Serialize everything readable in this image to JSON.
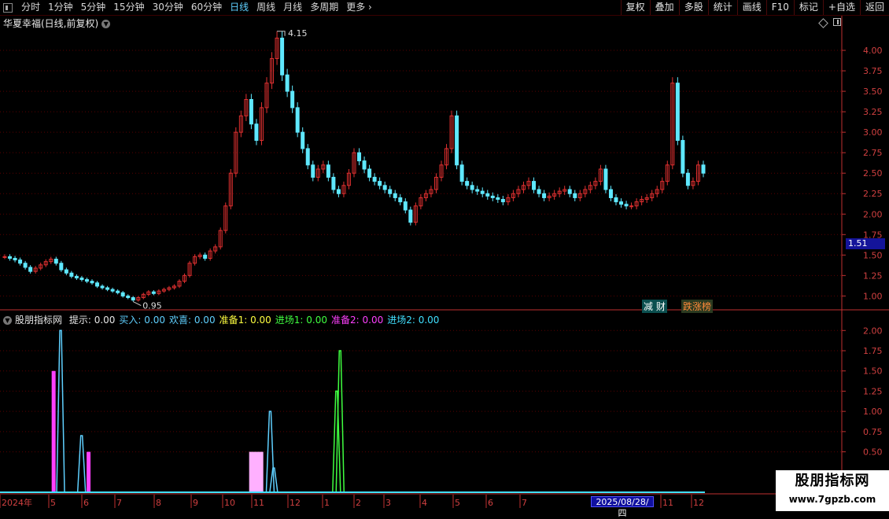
{
  "toolbar": {
    "periods": [
      "分时",
      "1分钟",
      "5分钟",
      "15分钟",
      "30分钟",
      "60分钟",
      "日线",
      "周线",
      "月线",
      "多周期",
      "更多 ›"
    ],
    "active_index": 6,
    "right_buttons": [
      "复权",
      "叠加",
      "多股",
      "统计",
      "画线",
      "F10",
      "标记",
      "+自选",
      "返回"
    ]
  },
  "stock": {
    "title": "华夏幸福(日线,前复权)"
  },
  "price_axis": {
    "ticks": [
      "4.00",
      "3.75",
      "3.50",
      "3.25",
      "3.00",
      "2.75",
      "2.50",
      "2.25",
      "2.00",
      "1.75",
      "1.50",
      "1.25",
      "1.00"
    ]
  },
  "current_price_badge": "1.51",
  "annotations": {
    "high_label": "4.15",
    "low_label": "0.95"
  },
  "tags": [
    {
      "text": "减 财",
      "color": "#ffffff",
      "bg": "#0b4f4f"
    },
    {
      "text": "跌涨榜",
      "color": "#ff8a3a",
      "bg": "#2b3a20"
    }
  ],
  "indicator": {
    "name": "股朋指标网",
    "fields": [
      {
        "label": "提示: 0.00",
        "color": "#e6e6e6"
      },
      {
        "label": "买入: 0.00",
        "color": "#5fd0ff"
      },
      {
        "label": "欢喜: 0.00",
        "color": "#5fd0ff"
      },
      {
        "label": "准备1: 0.00",
        "color": "#ffff40"
      },
      {
        "label": "进场1: 0.00",
        "color": "#40ff40"
      },
      {
        "label": "准备2: 0.00",
        "color": "#ff40ff"
      },
      {
        "label": "进场2: 0.00",
        "color": "#40e0ff"
      }
    ],
    "axis_ticks": [
      "2.00",
      "1.75",
      "1.50",
      "1.25",
      "1.00",
      "0.75",
      "0.50"
    ]
  },
  "time_axis": {
    "labels": [
      "2024年",
      "5",
      "6",
      "7",
      "8",
      "9",
      "10",
      "11",
      "12",
      "1",
      "2",
      "3",
      "4",
      "5",
      "6",
      "7",
      "11",
      "12"
    ]
  },
  "cursor_date": "2025/08/28/四",
  "watermark": {
    "line1": "股朋指标网",
    "line2": "www.7gpzb.com"
  },
  "colors": {
    "up": "#e03030",
    "down": "#5fe8ff",
    "grid": "#5a0000",
    "axis": "#c03030"
  },
  "chart_data": {
    "type": "candlestick",
    "price_ylim": [
      0.85,
      4.25
    ],
    "close_series": [
      1.48,
      1.46,
      1.44,
      1.4,
      1.35,
      1.3,
      1.34,
      1.38,
      1.42,
      1.45,
      1.4,
      1.32,
      1.28,
      1.24,
      1.22,
      1.2,
      1.18,
      1.16,
      1.12,
      1.1,
      1.08,
      1.06,
      1.04,
      1.0,
      0.98,
      0.95,
      0.98,
      1.02,
      1.05,
      1.03,
      1.06,
      1.08,
      1.1,
      1.12,
      1.18,
      1.25,
      1.4,
      1.48,
      1.5,
      1.46,
      1.55,
      1.6,
      1.8,
      2.1,
      2.5,
      3.0,
      3.2,
      3.4,
      3.1,
      2.9,
      3.3,
      3.6,
      3.9,
      4.15,
      3.7,
      3.5,
      3.3,
      3.0,
      2.8,
      2.6,
      2.45,
      2.55,
      2.6,
      2.45,
      2.3,
      2.25,
      2.35,
      2.5,
      2.75,
      2.65,
      2.55,
      2.45,
      2.4,
      2.35,
      2.3,
      2.25,
      2.2,
      2.15,
      2.05,
      1.9,
      2.1,
      2.2,
      2.25,
      2.3,
      2.45,
      2.6,
      2.8,
      3.2,
      2.6,
      2.4,
      2.35,
      2.3,
      2.28,
      2.25,
      2.22,
      2.2,
      2.18,
      2.15,
      2.2,
      2.25,
      2.3,
      2.35,
      2.4,
      2.3,
      2.25,
      2.2,
      2.22,
      2.25,
      2.28,
      2.3,
      2.25,
      2.2,
      2.25,
      2.3,
      2.35,
      2.4,
      2.55,
      2.3,
      2.2,
      2.15,
      2.12,
      2.1,
      2.1,
      2.15,
      2.18,
      2.2,
      2.25,
      2.3,
      2.4,
      2.6,
      3.6,
      2.9,
      2.5,
      2.35,
      2.4,
      2.6,
      2.5
    ],
    "indicator_ylim": [
      0,
      2.1
    ],
    "indicator_series": [
      {
        "name": "准备2",
        "color": "#ff40ff",
        "type": "bar",
        "points": [
          [
            0.07,
            1.5
          ],
          [
            0.12,
            0.5
          ]
        ]
      },
      {
        "name": "买入",
        "color": "#5fd0ff",
        "type": "line",
        "points": [
          [
            0.08,
            2.0
          ],
          [
            0.11,
            0.7
          ],
          [
            0.38,
            1.0
          ],
          [
            0.385,
            0.3
          ]
        ]
      },
      {
        "name": "准备1",
        "color": "#ffb0ff",
        "type": "bar",
        "points": [
          [
            0.36,
            0.5
          ]
        ]
      },
      {
        "name": "进场1",
        "color": "#40ff40",
        "type": "line",
        "points": [
          [
            0.48,
            1.75
          ],
          [
            0.475,
            1.25
          ]
        ]
      }
    ]
  }
}
